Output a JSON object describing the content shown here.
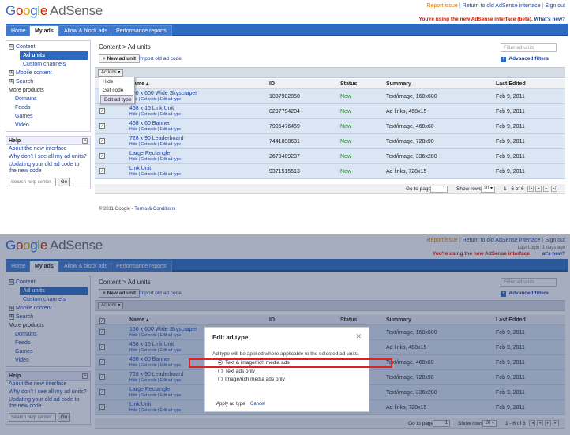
{
  "brand": {
    "name": "Google",
    "product": "AdSense"
  },
  "top_links": {
    "report": "Report issue",
    "return": "Return to old AdSense interface",
    "signout": "Sign out",
    "separator": "|"
  },
  "last_login": "Last Login: 1 days ago",
  "notice": {
    "text": "You're using the new AdSense interface (beta).",
    "text_short": "You're using the new AdSense interface",
    "link": "What's new?",
    "link_short": "at's new?"
  },
  "nav": {
    "tabs": [
      "Home",
      "My ads",
      "Allow & block ads",
      "Performance reports"
    ],
    "active": "My ads"
  },
  "sidebar": {
    "content": "Content",
    "ad_units": "Ad units",
    "custom_channels": "Custom channels",
    "mobile_content": "Mobile content",
    "search": "Search",
    "more_products": "More products",
    "domains": "Domains",
    "feeds": "Feeds",
    "games": "Games",
    "video": "Video",
    "expand": "⊟",
    "collapse": "⊞"
  },
  "help": {
    "title": "Help",
    "links": [
      "About the new interface",
      "Why don't I see all my ad units?",
      "Updating your old ad code to the new code"
    ],
    "search_placeholder": "Search help center",
    "go": "Go"
  },
  "main": {
    "breadcrumb": "Content > Ad units",
    "new_ad_unit": "+ New ad unit",
    "import": "Import old ad code",
    "filter_placeholder": "Filter ad units",
    "advanced_filters": "Advanced filters",
    "actions": "Actions ▾"
  },
  "actions_menu": {
    "items": [
      "Hide",
      "Get code",
      "Edit ad type"
    ]
  },
  "table": {
    "headers": {
      "name": "Name ▴",
      "id": "ID",
      "status": "Status",
      "summary": "Summary",
      "last_edited": "Last Edited"
    },
    "row_links": "Hide | Get code | Edit ad type",
    "rows": [
      {
        "name": "160 x 600 Wide Skyscraper",
        "id": "1887982850",
        "status": "New",
        "summary": "Text/image, 160x600",
        "edited": "Feb 9, 2011"
      },
      {
        "name": "468 x 15 Link Unit",
        "id": "0297794204",
        "status": "New",
        "summary": "Ad links, 468x15",
        "edited": "Feb 9, 2011"
      },
      {
        "name": "468 x 60 Banner",
        "id": "7905476459",
        "status": "New",
        "summary": "Text/image, 468x60",
        "edited": "Feb 9, 2011"
      },
      {
        "name": "728 x 90 Leaderboard",
        "id": "7441898631",
        "status": "New",
        "summary": "Text/image, 728x90",
        "edited": "Feb 9, 2011"
      },
      {
        "name": "Large Rectangle",
        "id": "2679409237",
        "status": "New",
        "summary": "Text/image, 336x280",
        "edited": "Feb 9, 2011"
      },
      {
        "name": "Link Unit",
        "id": "9371515513",
        "status": "New",
        "summary": "Ad links, 728x15",
        "edited": "Feb 9, 2011"
      }
    ]
  },
  "pager": {
    "goto_label": "Go to page:",
    "page": "1",
    "rows_label": "Show rows:",
    "rows": "20 ▾",
    "range": "1 - 6 of 6",
    "first": "|◂",
    "prev": "◂",
    "next": "▸",
    "last": "▸|"
  },
  "footer": {
    "copyright": "© 2011 Google -",
    "terms": "Terms & Conditions"
  },
  "dialog": {
    "title": "Edit ad type",
    "close": "✕",
    "description": "Ad type will be applied where applicable to the selected ad units.",
    "options": [
      "Text & image/rich media ads",
      "Text ads only",
      "Image/rich media ads only"
    ],
    "apply": "Apply ad type",
    "cancel": "Cancel"
  },
  "checkmark": "✓"
}
